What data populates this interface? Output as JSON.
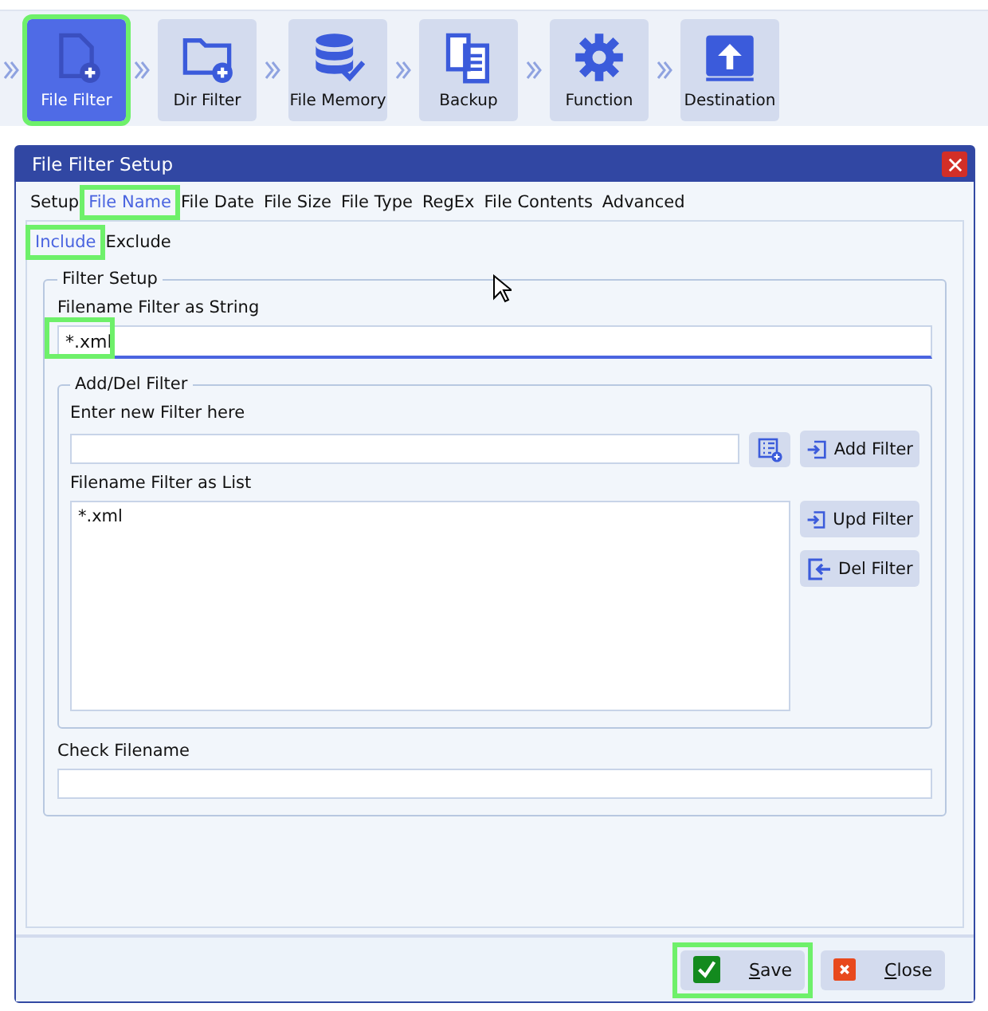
{
  "toolbar": [
    {
      "label": "File Filter",
      "kind": "file",
      "selected": true,
      "highlighted": true
    },
    {
      "label": "Dir Filter",
      "kind": "folder",
      "selected": false,
      "highlighted": false
    },
    {
      "label": "File Memory",
      "kind": "database",
      "selected": false,
      "highlighted": false
    },
    {
      "label": "Backup",
      "kind": "copy",
      "selected": false,
      "highlighted": false
    },
    {
      "label": "Function",
      "kind": "gear",
      "selected": false,
      "highlighted": false
    },
    {
      "label": "Destination",
      "kind": "upload",
      "selected": false,
      "highlighted": false
    }
  ],
  "dialog": {
    "title": "File Filter Setup",
    "tabs": [
      {
        "label": "Setup",
        "selected": false,
        "highlighted": false
      },
      {
        "label": "File Name",
        "selected": true,
        "highlighted": true
      },
      {
        "label": "File Date",
        "selected": false,
        "highlighted": false
      },
      {
        "label": "File Size",
        "selected": false,
        "highlighted": false
      },
      {
        "label": "File Type",
        "selected": false,
        "highlighted": false
      },
      {
        "label": "RegEx",
        "selected": false,
        "highlighted": false
      },
      {
        "label": "File Contents",
        "selected": false,
        "highlighted": false
      },
      {
        "label": "Advanced",
        "selected": false,
        "highlighted": false
      }
    ],
    "subtabs": [
      {
        "label": "Include",
        "selected": true,
        "highlighted": true
      },
      {
        "label": "Exclude",
        "selected": false,
        "highlighted": false
      }
    ],
    "group_title": "Filter Setup",
    "string_label": "Filename Filter as String",
    "string_value": "*.xml",
    "string_highlighted": true,
    "adddel_title": "Add/Del Filter",
    "new_label": "Enter new Filter here",
    "add_button": "Add Filter",
    "list_label": "Filename Filter as List",
    "list_items": [
      "*.xml"
    ],
    "upd_button": "Upd Filter",
    "del_button": "Del Filter",
    "check_label": "Check Filename",
    "buttons": [
      {
        "label": "Save",
        "kind": "save",
        "highlighted": true
      },
      {
        "label": "Close",
        "kind": "close",
        "highlighted": false
      }
    ]
  }
}
